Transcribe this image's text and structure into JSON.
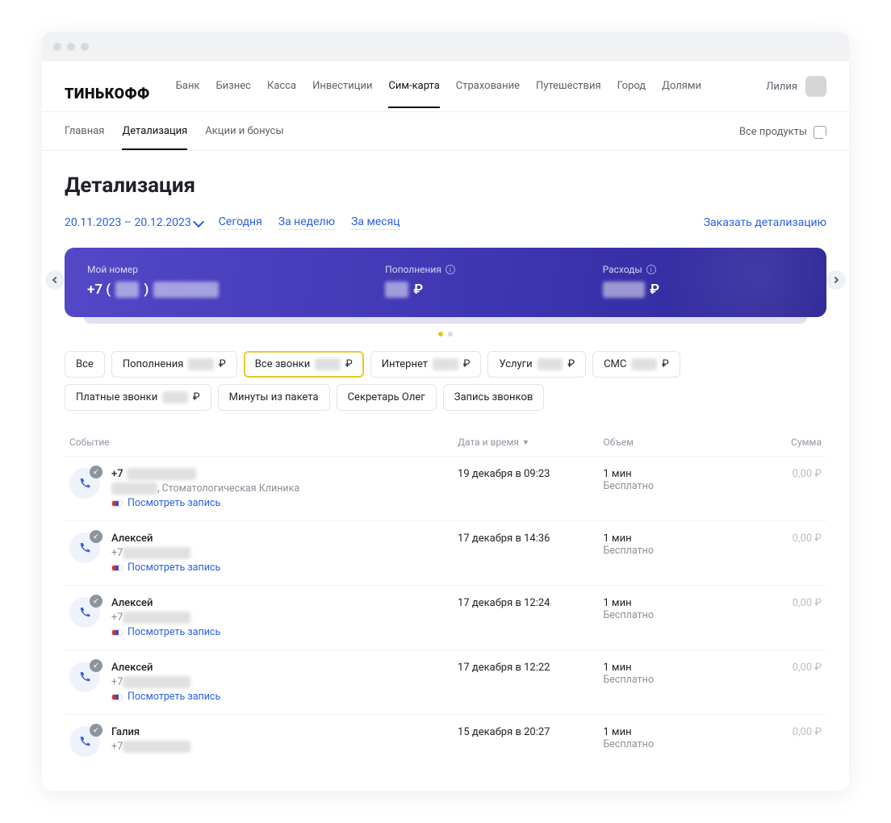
{
  "brand": "ТИНЬКОФФ",
  "topNav": [
    "Банк",
    "Бизнес",
    "Касса",
    "Инвестиции",
    "Сим-карта",
    "Страхование",
    "Путешествия",
    "Город",
    "Долями"
  ],
  "topNavActive": "Сим-карта",
  "user": {
    "name": "Лилия"
  },
  "subNav": [
    "Главная",
    "Детализация",
    "Акции и бонусы"
  ],
  "subNavActive": "Детализация",
  "allProducts": "Все продукты",
  "pageTitle": "Детализация",
  "dateRange": "20.11.2023 – 20.12.2023",
  "quick": {
    "today": "Сегодня",
    "week": "За неделю",
    "month": "За месяц"
  },
  "orderDetail": "Заказать детализацию",
  "summary": {
    "myNumberLabel": "Мой номер",
    "myNumberPrefix": "+7 (",
    "topupsLabel": "Пополнения",
    "expensesLabel": "Расходы",
    "ruble": "₽"
  },
  "chips": [
    {
      "label": "Все",
      "hasAmount": false,
      "active": false
    },
    {
      "label": "Пополнения",
      "hasAmount": true,
      "active": false
    },
    {
      "label": "Все звонки",
      "hasAmount": true,
      "active": true
    },
    {
      "label": "Интернет",
      "hasAmount": true,
      "active": false
    },
    {
      "label": "Услуги",
      "hasAmount": true,
      "active": false
    },
    {
      "label": "СМС",
      "hasAmount": true,
      "active": false
    },
    {
      "label": "Платные звонки",
      "hasAmount": true,
      "active": false
    },
    {
      "label": "Минуты из пакета",
      "hasAmount": false,
      "active": false
    },
    {
      "label": "Секретарь Олег",
      "hasAmount": false,
      "active": false
    },
    {
      "label": "Запись звонков",
      "hasAmount": false,
      "active": false
    }
  ],
  "columns": {
    "event": "Событие",
    "datetime": "Дата и время",
    "volume": "Объем",
    "sum": "Сумма"
  },
  "viewRecord": "Посмотреть запись",
  "free": "Бесплатно",
  "ruble": "₽",
  "rows": [
    {
      "title": "+7",
      "titleRedacted": true,
      "sub": ", Стоматологическая Клиника",
      "subRedactedPrefix": true,
      "hasRecord": true,
      "datetime": "19 декабря в 09:23",
      "volume": "1 мин",
      "sum": "0,00"
    },
    {
      "title": "Алексей",
      "titleRedacted": false,
      "sub": "+7",
      "subRedactedSuffix": true,
      "hasRecord": true,
      "datetime": "17 декабря в 14:36",
      "volume": "1 мин",
      "sum": "0,00"
    },
    {
      "title": "Алексей",
      "titleRedacted": false,
      "sub": "+7",
      "subRedactedSuffix": true,
      "hasRecord": true,
      "datetime": "17 декабря в 12:24",
      "volume": "1 мин",
      "sum": "0,00"
    },
    {
      "title": "Алексей",
      "titleRedacted": false,
      "sub": "+7",
      "subRedactedSuffix": true,
      "hasRecord": true,
      "datetime": "17 декабря в 12:22",
      "volume": "1 мин",
      "sum": "0,00"
    },
    {
      "title": "Галия",
      "titleRedacted": false,
      "sub": "+7",
      "subRedactedSuffix": true,
      "hasRecord": false,
      "datetime": "15 декабря в 20:27",
      "volume": "1 мин",
      "sum": "0,00"
    }
  ]
}
